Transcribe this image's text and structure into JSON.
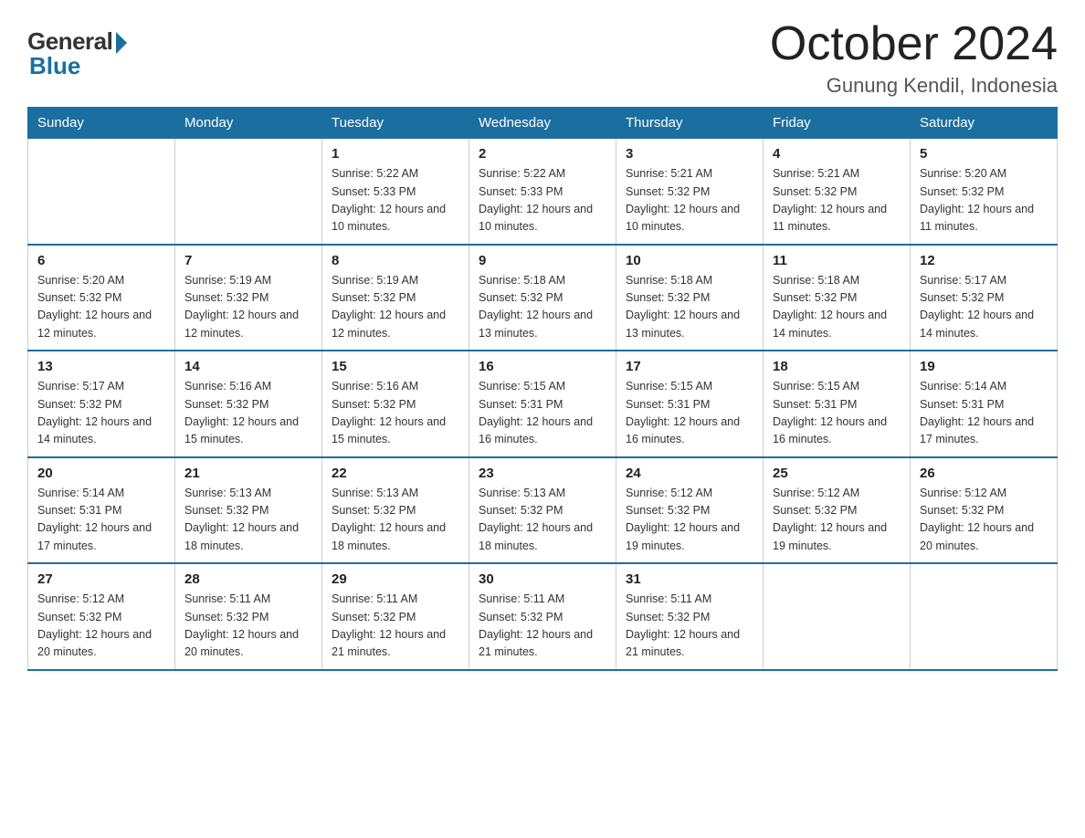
{
  "header": {
    "logo_general": "General",
    "logo_blue": "Blue",
    "month": "October 2024",
    "location": "Gunung Kendil, Indonesia"
  },
  "days_of_week": [
    "Sunday",
    "Monday",
    "Tuesday",
    "Wednesday",
    "Thursday",
    "Friday",
    "Saturday"
  ],
  "weeks": [
    [
      {
        "day": "",
        "sunrise": "",
        "sunset": "",
        "daylight": ""
      },
      {
        "day": "",
        "sunrise": "",
        "sunset": "",
        "daylight": ""
      },
      {
        "day": "1",
        "sunrise": "Sunrise: 5:22 AM",
        "sunset": "Sunset: 5:33 PM",
        "daylight": "Daylight: 12 hours and 10 minutes."
      },
      {
        "day": "2",
        "sunrise": "Sunrise: 5:22 AM",
        "sunset": "Sunset: 5:33 PM",
        "daylight": "Daylight: 12 hours and 10 minutes."
      },
      {
        "day": "3",
        "sunrise": "Sunrise: 5:21 AM",
        "sunset": "Sunset: 5:32 PM",
        "daylight": "Daylight: 12 hours and 10 minutes."
      },
      {
        "day": "4",
        "sunrise": "Sunrise: 5:21 AM",
        "sunset": "Sunset: 5:32 PM",
        "daylight": "Daylight: 12 hours and 11 minutes."
      },
      {
        "day": "5",
        "sunrise": "Sunrise: 5:20 AM",
        "sunset": "Sunset: 5:32 PM",
        "daylight": "Daylight: 12 hours and 11 minutes."
      }
    ],
    [
      {
        "day": "6",
        "sunrise": "Sunrise: 5:20 AM",
        "sunset": "Sunset: 5:32 PM",
        "daylight": "Daylight: 12 hours and 12 minutes."
      },
      {
        "day": "7",
        "sunrise": "Sunrise: 5:19 AM",
        "sunset": "Sunset: 5:32 PM",
        "daylight": "Daylight: 12 hours and 12 minutes."
      },
      {
        "day": "8",
        "sunrise": "Sunrise: 5:19 AM",
        "sunset": "Sunset: 5:32 PM",
        "daylight": "Daylight: 12 hours and 12 minutes."
      },
      {
        "day": "9",
        "sunrise": "Sunrise: 5:18 AM",
        "sunset": "Sunset: 5:32 PM",
        "daylight": "Daylight: 12 hours and 13 minutes."
      },
      {
        "day": "10",
        "sunrise": "Sunrise: 5:18 AM",
        "sunset": "Sunset: 5:32 PM",
        "daylight": "Daylight: 12 hours and 13 minutes."
      },
      {
        "day": "11",
        "sunrise": "Sunrise: 5:18 AM",
        "sunset": "Sunset: 5:32 PM",
        "daylight": "Daylight: 12 hours and 14 minutes."
      },
      {
        "day": "12",
        "sunrise": "Sunrise: 5:17 AM",
        "sunset": "Sunset: 5:32 PM",
        "daylight": "Daylight: 12 hours and 14 minutes."
      }
    ],
    [
      {
        "day": "13",
        "sunrise": "Sunrise: 5:17 AM",
        "sunset": "Sunset: 5:32 PM",
        "daylight": "Daylight: 12 hours and 14 minutes."
      },
      {
        "day": "14",
        "sunrise": "Sunrise: 5:16 AM",
        "sunset": "Sunset: 5:32 PM",
        "daylight": "Daylight: 12 hours and 15 minutes."
      },
      {
        "day": "15",
        "sunrise": "Sunrise: 5:16 AM",
        "sunset": "Sunset: 5:32 PM",
        "daylight": "Daylight: 12 hours and 15 minutes."
      },
      {
        "day": "16",
        "sunrise": "Sunrise: 5:15 AM",
        "sunset": "Sunset: 5:31 PM",
        "daylight": "Daylight: 12 hours and 16 minutes."
      },
      {
        "day": "17",
        "sunrise": "Sunrise: 5:15 AM",
        "sunset": "Sunset: 5:31 PM",
        "daylight": "Daylight: 12 hours and 16 minutes."
      },
      {
        "day": "18",
        "sunrise": "Sunrise: 5:15 AM",
        "sunset": "Sunset: 5:31 PM",
        "daylight": "Daylight: 12 hours and 16 minutes."
      },
      {
        "day": "19",
        "sunrise": "Sunrise: 5:14 AM",
        "sunset": "Sunset: 5:31 PM",
        "daylight": "Daylight: 12 hours and 17 minutes."
      }
    ],
    [
      {
        "day": "20",
        "sunrise": "Sunrise: 5:14 AM",
        "sunset": "Sunset: 5:31 PM",
        "daylight": "Daylight: 12 hours and 17 minutes."
      },
      {
        "day": "21",
        "sunrise": "Sunrise: 5:13 AM",
        "sunset": "Sunset: 5:32 PM",
        "daylight": "Daylight: 12 hours and 18 minutes."
      },
      {
        "day": "22",
        "sunrise": "Sunrise: 5:13 AM",
        "sunset": "Sunset: 5:32 PM",
        "daylight": "Daylight: 12 hours and 18 minutes."
      },
      {
        "day": "23",
        "sunrise": "Sunrise: 5:13 AM",
        "sunset": "Sunset: 5:32 PM",
        "daylight": "Daylight: 12 hours and 18 minutes."
      },
      {
        "day": "24",
        "sunrise": "Sunrise: 5:12 AM",
        "sunset": "Sunset: 5:32 PM",
        "daylight": "Daylight: 12 hours and 19 minutes."
      },
      {
        "day": "25",
        "sunrise": "Sunrise: 5:12 AM",
        "sunset": "Sunset: 5:32 PM",
        "daylight": "Daylight: 12 hours and 19 minutes."
      },
      {
        "day": "26",
        "sunrise": "Sunrise: 5:12 AM",
        "sunset": "Sunset: 5:32 PM",
        "daylight": "Daylight: 12 hours and 20 minutes."
      }
    ],
    [
      {
        "day": "27",
        "sunrise": "Sunrise: 5:12 AM",
        "sunset": "Sunset: 5:32 PM",
        "daylight": "Daylight: 12 hours and 20 minutes."
      },
      {
        "day": "28",
        "sunrise": "Sunrise: 5:11 AM",
        "sunset": "Sunset: 5:32 PM",
        "daylight": "Daylight: 12 hours and 20 minutes."
      },
      {
        "day": "29",
        "sunrise": "Sunrise: 5:11 AM",
        "sunset": "Sunset: 5:32 PM",
        "daylight": "Daylight: 12 hours and 21 minutes."
      },
      {
        "day": "30",
        "sunrise": "Sunrise: 5:11 AM",
        "sunset": "Sunset: 5:32 PM",
        "daylight": "Daylight: 12 hours and 21 minutes."
      },
      {
        "day": "31",
        "sunrise": "Sunrise: 5:11 AM",
        "sunset": "Sunset: 5:32 PM",
        "daylight": "Daylight: 12 hours and 21 minutes."
      },
      {
        "day": "",
        "sunrise": "",
        "sunset": "",
        "daylight": ""
      },
      {
        "day": "",
        "sunrise": "",
        "sunset": "",
        "daylight": ""
      }
    ]
  ]
}
